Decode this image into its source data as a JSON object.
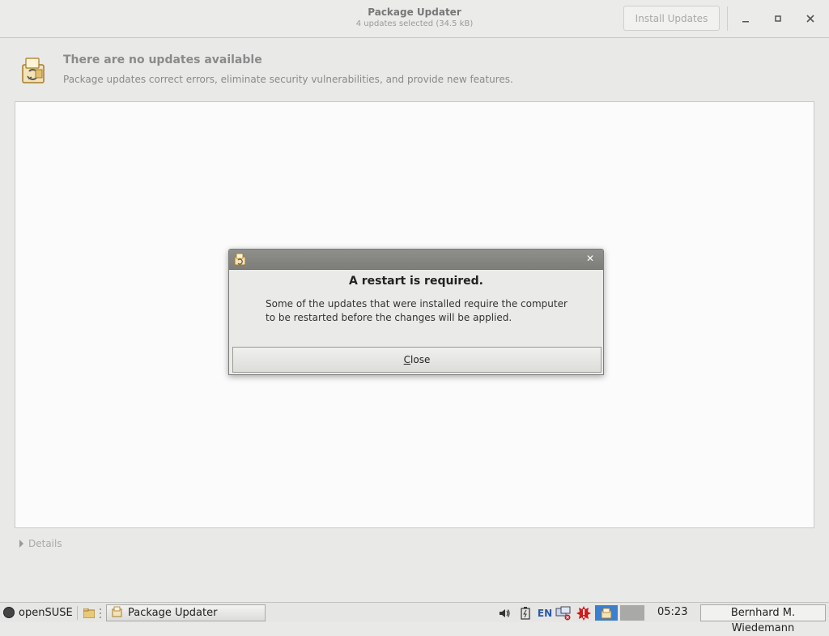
{
  "window": {
    "title": "Package Updater",
    "subtitle": "4 updates selected (34.5 kB)",
    "install_button": "Install Updates",
    "controls": {
      "minimize": "minimize-icon",
      "maximize": "maximize-icon",
      "close": "close-icon"
    }
  },
  "message": {
    "icon": "package-updater-icon",
    "title": "There are no updates available",
    "description": "Package updates correct errors, eliminate security vulnerabilities, and provide new features."
  },
  "details": {
    "label": "Details"
  },
  "dialog": {
    "icon": "package-updater-icon",
    "heading": "A restart is required.",
    "body": "Some of the updates that were installed require the computer to be restarted before the changes will be applied.",
    "button_mnemonic": "C",
    "button_rest": "lose"
  },
  "taskbar": {
    "start_label": "openSUSE",
    "task_label": "Package Updater",
    "keyboard_layout": "EN",
    "clock": "05:23",
    "user": "Bernhard M. Wiedemann",
    "tray_icons": [
      "volume-icon",
      "battery-icon",
      "keyboard-layout",
      "network-disconnected-icon",
      "alert-icon",
      "package-updater-tray-icon"
    ]
  },
  "colors": {
    "accent_tray": "#3a7fd0",
    "alert": "#d11a1a",
    "dialog_titlebar": "#878784"
  }
}
